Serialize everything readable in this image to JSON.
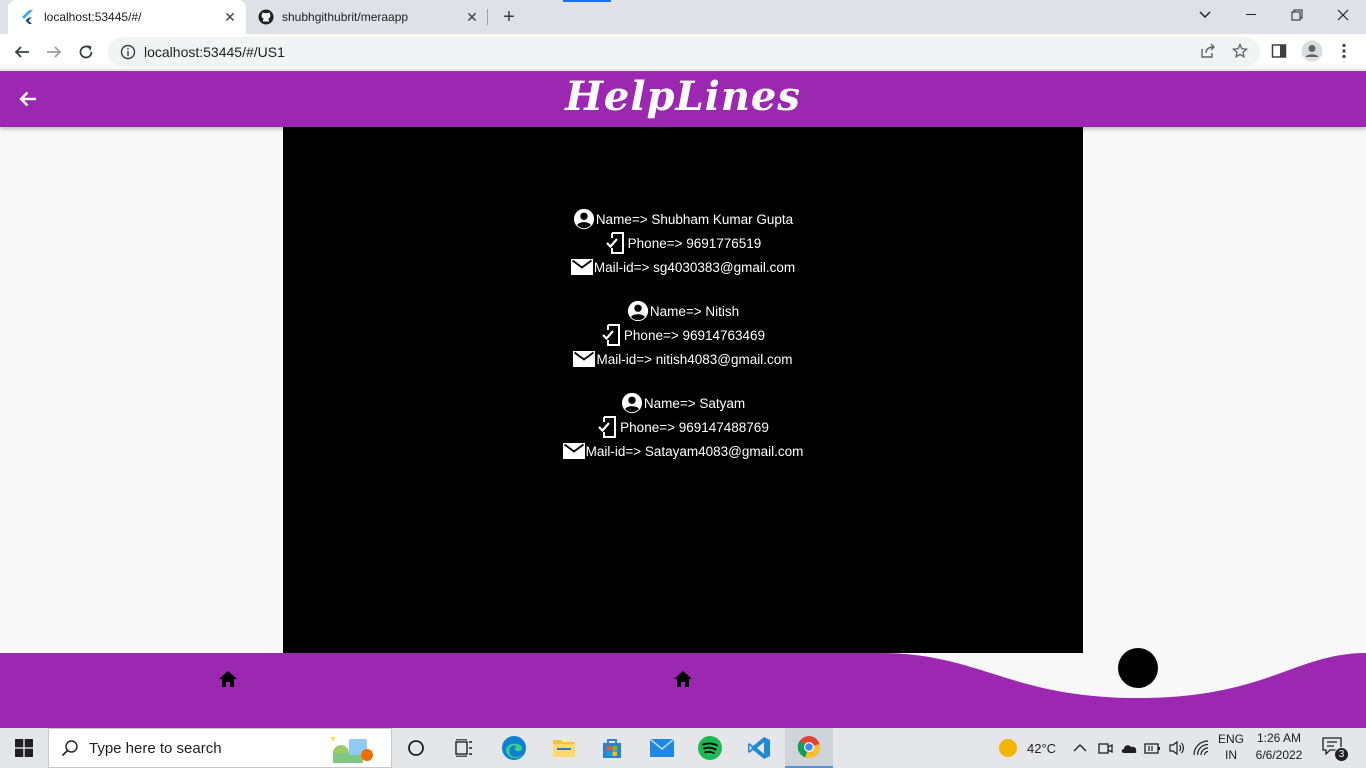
{
  "browser": {
    "tabs": [
      {
        "title": "localhost:53445/#/",
        "icon": "flutter-icon",
        "active": true
      },
      {
        "title": "shubhgithubrit/meraapp",
        "icon": "github-icon",
        "active": false
      }
    ],
    "url": "localhost:53445/#/US1"
  },
  "app": {
    "title": "HelpLines",
    "accent": "#9c27b0",
    "panel_color": "#000000"
  },
  "contacts": [
    {
      "name": "Name=> Shubham Kumar Gupta",
      "phone": "Phone=> 9691776519",
      "mail": "Mail-id=> sg4030383@gmail.com"
    },
    {
      "name": "Name=> Nitish",
      "phone": "Phone=> 96914763469",
      "mail": "Mail-id=> nitish4083@gmail.com"
    },
    {
      "name": "Name=> Satyam",
      "phone": "Phone=> 969147488769",
      "mail": "Mail-id=> Satayam4083@gmail.com"
    }
  ],
  "bottom_nav": {
    "items": [
      {
        "icon": "home-icon"
      },
      {
        "icon": "home-icon"
      }
    ],
    "selected_index": 2
  },
  "taskbar": {
    "search_placeholder": "Type here to search",
    "weather": "42°C",
    "lang_top": "ENG",
    "lang_bottom": "IN",
    "time": "1:26 AM",
    "date": "6/6/2022",
    "notification_count": "3"
  }
}
